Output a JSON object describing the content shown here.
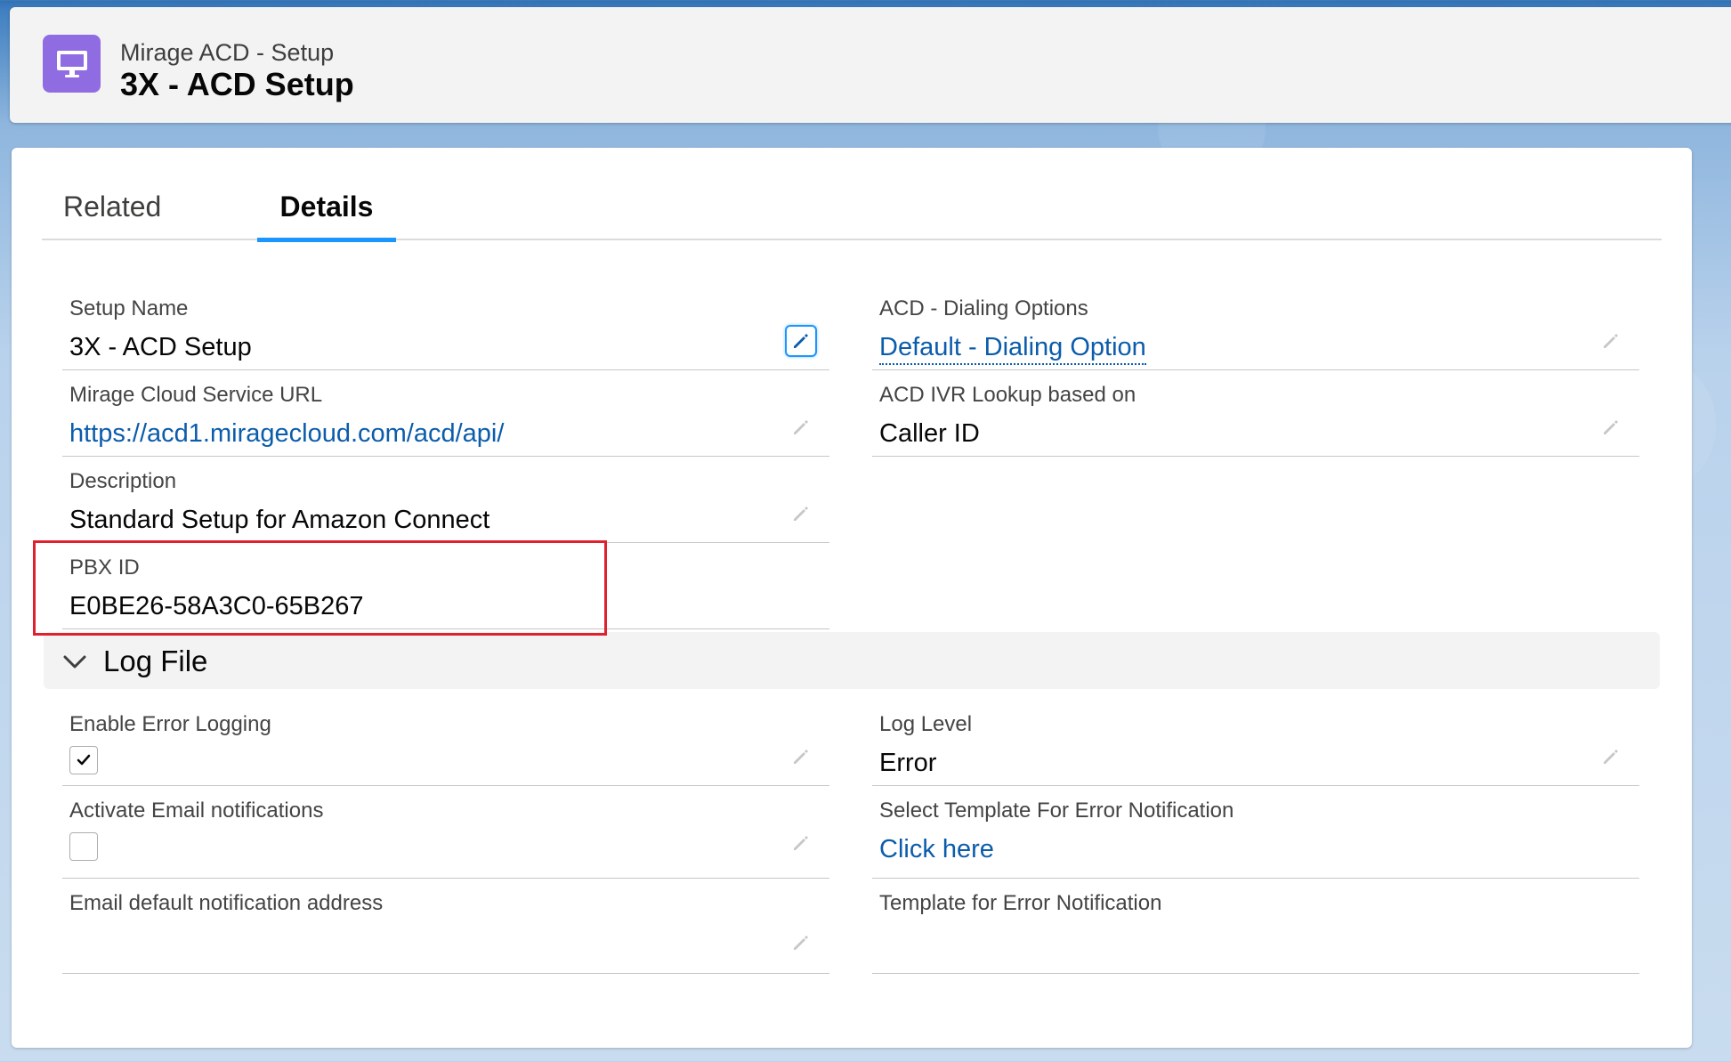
{
  "header": {
    "subtitle": "Mirage ACD - Setup",
    "title": "3X - ACD Setup",
    "icon": "desktop-icon",
    "icon_color": "#8f6ce2"
  },
  "tabs": [
    {
      "label": "Related",
      "active": false
    },
    {
      "label": "Details",
      "active": true
    }
  ],
  "fields": {
    "setup_name": {
      "label": "Setup Name",
      "value": "3X - ACD Setup"
    },
    "service_url": {
      "label": "Mirage Cloud Service URL",
      "value": "https://acd1.miragecloud.com/acd/api/"
    },
    "description": {
      "label": "Description",
      "value": "Standard Setup for Amazon Connect"
    },
    "pbx_id": {
      "label": "PBX ID",
      "value": "E0BE26-58A3C0-65B267"
    },
    "dialing_options": {
      "label": "ACD - Dialing Options",
      "value": "Default - Dialing Option"
    },
    "ivr_lookup": {
      "label": "ACD IVR Lookup based on",
      "value": "Caller ID"
    }
  },
  "log_section": {
    "title": "Log File",
    "fields": {
      "enable_error_logging": {
        "label": "Enable Error Logging",
        "checked": true
      },
      "activate_email": {
        "label": "Activate Email notifications",
        "checked": false
      },
      "email_address": {
        "label": "Email default notification address",
        "value": ""
      },
      "log_level": {
        "label": "Log Level",
        "value": "Error"
      },
      "select_template": {
        "label": "Select Template For Error Notification",
        "value": "Click here"
      },
      "template": {
        "label": "Template for Error Notification",
        "value": ""
      }
    }
  },
  "colors": {
    "link": "#0b5cab",
    "active_tab": "#1b96ff",
    "highlight": "#e0202f"
  }
}
